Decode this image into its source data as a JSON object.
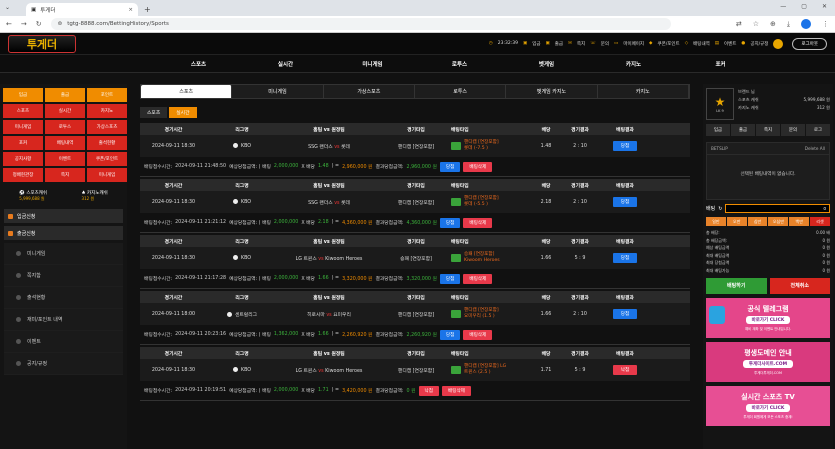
{
  "browser": {
    "tab_title": "투게더",
    "url": "tgtg-8888.com/BettingHistory/Sports"
  },
  "header": {
    "logo": "투게더",
    "time": "23:32:39",
    "links": [
      "입금",
      "출금",
      "쪽지",
      "문의",
      "마이페이지",
      "쿠폰/포인트",
      "배팅내역",
      "이벤트",
      "공지/규정"
    ],
    "logout": "로그아웃"
  },
  "gnav": [
    "스포츠",
    "실시간",
    "미니게임",
    "로투스",
    "벳게임",
    "카지노",
    "포커"
  ],
  "left": {
    "grid": [
      [
        "입금",
        "출금",
        "포인트"
      ],
      [
        "스포츠",
        "실시간",
        "카지노"
      ],
      [
        "미니게임",
        "로투스",
        "가상스포츠"
      ],
      [
        "포커",
        "배팅내역",
        "출석현황"
      ],
      [
        "공지사항",
        "이벤트",
        "쿠폰/포인트"
      ],
      [
        "정배현관장",
        "쪽지",
        "미니게임"
      ]
    ],
    "sports_label": "스포츠캐쉬",
    "sports_val": "5,999,688 원",
    "casino_label": "카지노캐쉬",
    "casino_val": "312 원",
    "sec1": "입금신청",
    "sec2": "출금신청",
    "menu": [
      "미니게임",
      "쪽지함",
      "출석현황",
      "재미/포인트 내역",
      "이벤트",
      "공지/규정"
    ]
  },
  "subtabs": [
    "스포츠",
    "미니게임",
    "가상스포츠",
    "로투스",
    "벳게임 카지노",
    "카지노"
  ],
  "sub2": [
    "스포츠",
    "실시간"
  ],
  "cols": [
    "경기시간",
    "리그명",
    "홈팀 vs 원정팀",
    "경기타입",
    "배팅타입",
    "배당",
    "경기결과",
    "배팅결과"
  ],
  "bets": [
    {
      "time": "2024-09-11 18:30",
      "league": "KBO",
      "home": "SSG 랜더스",
      "away": "롯데",
      "type": "핸디캡 [연장포함]",
      "pick1": "핸디캡 [연장포함]",
      "pick2": "롯데 (-7.5 )",
      "odds": "1.48",
      "score": "2 : 10",
      "result": "당첨",
      "res_cls": "w",
      "foot_time": "2024-09-11 21:48:50",
      "stake": "2,000,000",
      "fodds": "1.48",
      "expect": "2,960,000 원",
      "win": "2,960,000 원",
      "fres": "당첨"
    },
    {
      "time": "2024-09-11 18:30",
      "league": "KBO",
      "home": "SSG 랜더스",
      "away": "롯데",
      "type": "핸디캡 [연장포함]",
      "pick1": "핸디캡 [연장포함]",
      "pick2": "롯데 (-5.5 )",
      "odds": "2.18",
      "score": "2 : 10",
      "result": "당첨",
      "res_cls": "w",
      "foot_time": "2024-09-11 21:21:12",
      "stake": "2,000,000",
      "fodds": "2.18",
      "expect": "4,360,000 원",
      "win": "4,360,000 원",
      "fres": "당첨"
    },
    {
      "time": "2024-09-11 18:30",
      "league": "KBO",
      "home": "LG 트윈스",
      "away": "Kiwoom Heroes",
      "type": "승패 [연장포함]",
      "pick1": "승패 [연장포함]",
      "pick2": "Kiwoom Heroes",
      "odds": "1.66",
      "score": "5 : 9",
      "result": "당첨",
      "res_cls": "w",
      "foot_time": "2024-09-11 21:17:28",
      "stake": "2,000,000",
      "fodds": "1.66",
      "expect": "3,320,000 원",
      "win": "3,320,000 원",
      "fres": "당첨"
    },
    {
      "time": "2024-09-11 18:00",
      "league": "센트럴리그",
      "home": "히로시마",
      "away": "요미우리",
      "type": "핸디캡 [연장포함]",
      "pick1": "핸디캡 [연장포함]",
      "pick2": "요미우리 (1.5 )",
      "odds": "1.66",
      "score": "2 : 10",
      "result": "당첨",
      "res_cls": "w",
      "foot_time": "2024-09-11 20:23:16",
      "stake": "1,362,000",
      "fodds": "1.66",
      "expect": "2,260,920 원",
      "win": "2,260,920 원",
      "fres": "당첨"
    },
    {
      "time": "2024-09-11 18:30",
      "league": "KBO",
      "home": "LG 트윈스",
      "away": "Kiwoom Heroes",
      "type": "핸디캡 [연장포함]",
      "pick1": "핸디캡 [연장포함] LG",
      "pick2": "트윈스 (2.5 )",
      "odds": "1.71",
      "score": "5 : 9",
      "result": "낙첨",
      "res_cls": "l",
      "foot_time": "2024-09-11 20:19:51",
      "stake": "2,000,000",
      "fodds": "1.71",
      "expect": "3,420,000 원",
      "win": "0 원",
      "fres": "낙첨"
    }
  ],
  "foot_labels": {
    "bet_time": "배팅접수시간:",
    "exp": "예상당첨금액: ( 배팅",
    "x": "X 배당",
    "eq": ")  =",
    "win": "결과당첨금액:",
    "del": "배팅삭제"
  },
  "right": {
    "user": "브랜드 님",
    "level": "LK 9",
    "sports_cash_l": "스포츠 캐쉬",
    "sports_cash": "5,999,688 원",
    "casino_cash_l": "카지노 캐쉬",
    "casino_cash": "312 원",
    "btns": [
      "입금",
      "출금",
      "쪽지",
      "문의",
      "로그"
    ],
    "betslip": "BETSLIP",
    "delete_all": "Delete All",
    "empty": "선택된 배팅내역이 없습니다.",
    "stake_label": "배팅",
    "chips": [
      "일만",
      "오만",
      "십만",
      "오십만",
      "백만",
      "리셋"
    ],
    "sums": [
      [
        "총 배당:",
        "0.00 배"
      ],
      [
        "총 배당금액:",
        "0 원"
      ],
      [
        "예상 배팅금액",
        "0 원"
      ],
      [
        "최대 배팅금액",
        "0 원"
      ],
      [
        "최대 당첨금액",
        "0 원"
      ],
      [
        "최대 배팅가능",
        "0 원"
      ]
    ],
    "bet_btn": "배팅하기",
    "clear_btn": "전체취소",
    "ads": [
      {
        "t": "공식 텔레그램",
        "b": "바로가기 CLICK",
        "s": "예비 계좌 및 이벤트 안내입니다."
      },
      {
        "t": "평생도메인 안내",
        "b": "투게더사이트.COM",
        "s": "투게더투게더.COM"
      },
      {
        "t": "실시간 스포츠 TV",
        "b": "바로가기 CLICK",
        "s": "투게더 회원에게 모든 스포츠 중계!"
      }
    ]
  }
}
